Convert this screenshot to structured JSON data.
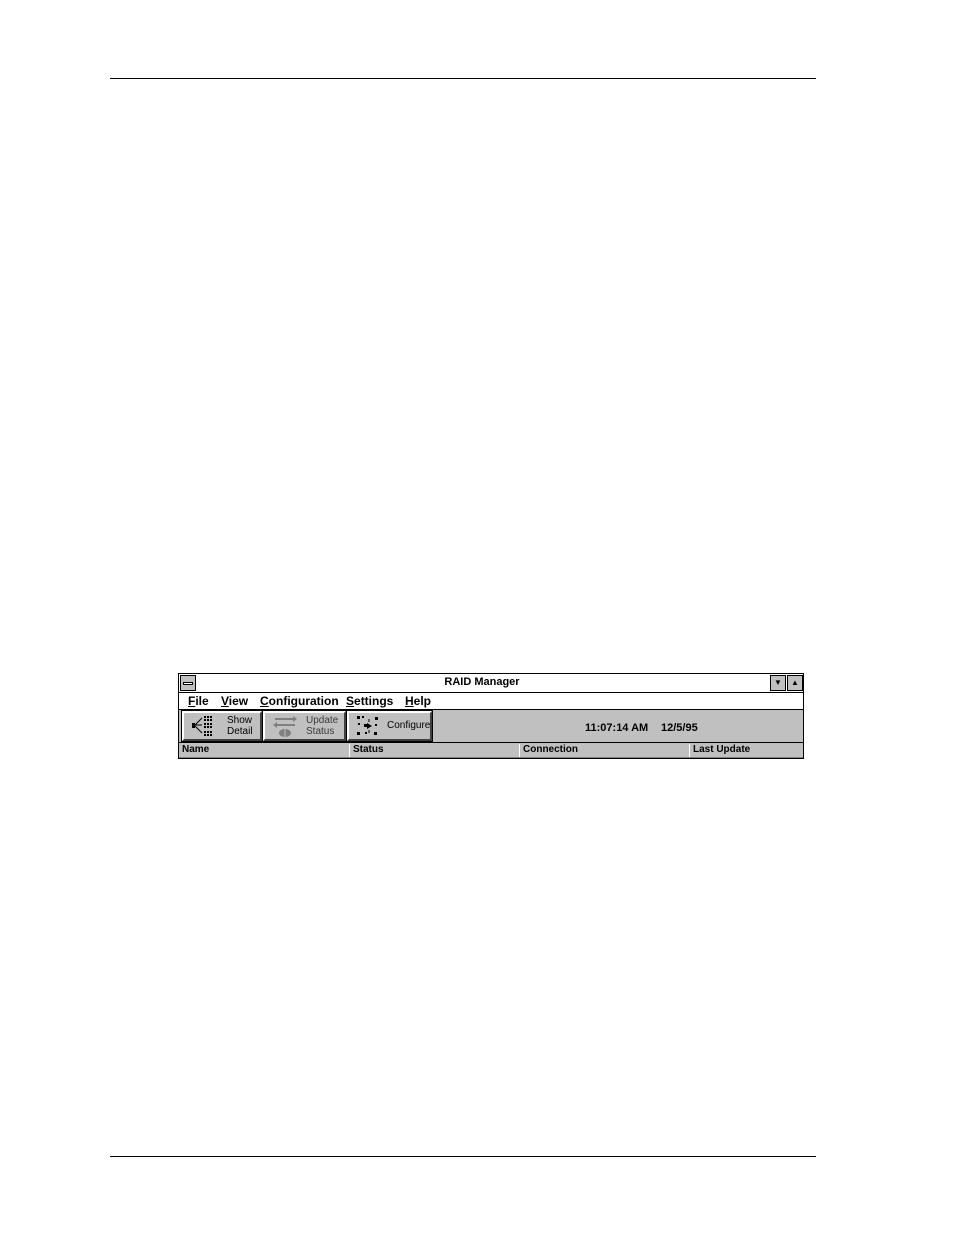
{
  "window": {
    "title": "RAID Manager"
  },
  "menu": {
    "items": [
      {
        "mnemonic": "F",
        "rest": "ile"
      },
      {
        "mnemonic": "V",
        "rest": "iew"
      },
      {
        "mnemonic": "C",
        "rest": "onfiguration"
      },
      {
        "mnemonic": "S",
        "rest": "ettings"
      },
      {
        "mnemonic": "H",
        "rest": "elp"
      }
    ]
  },
  "toolbar": {
    "show_detail": {
      "line1": "Show",
      "line2": "Detail",
      "icon": "show-detail-icon"
    },
    "update_status": {
      "line1": "Update",
      "line2": "Status",
      "icon": "update-status-icon",
      "enabled": false
    },
    "configure": {
      "label": "Configure",
      "icon": "configure-icon"
    },
    "time": "11:07:14 AM",
    "date": "12/5/95"
  },
  "table": {
    "columns": [
      "Name",
      "Status",
      "Connection",
      "Last Update"
    ]
  }
}
